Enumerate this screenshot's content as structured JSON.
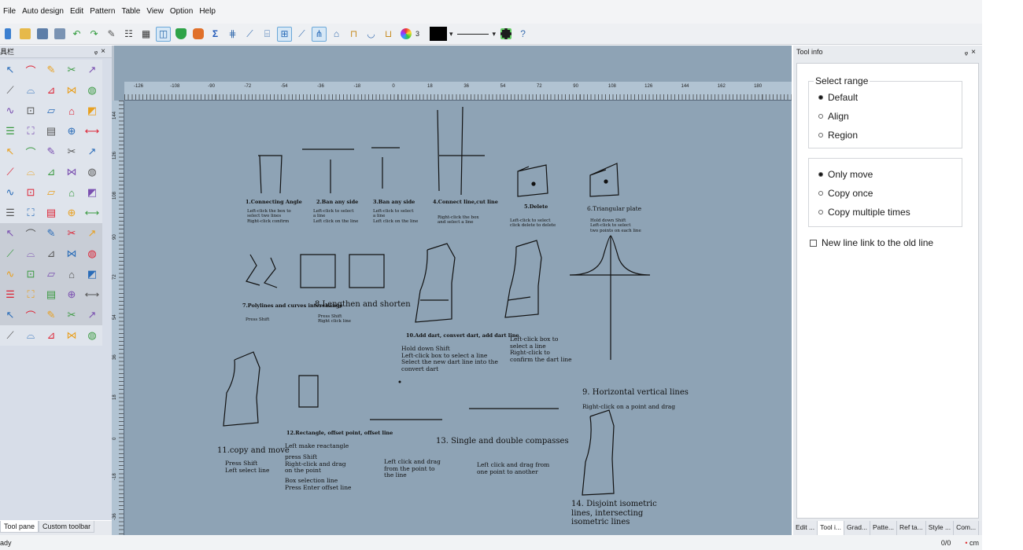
{
  "menu": [
    "File",
    "Auto design",
    "Edit",
    "Pattern",
    "Table",
    "View",
    "Option",
    "Help"
  ],
  "toolbar": {
    "line_weight_value": "3"
  },
  "left_pane": {
    "title": "具栏",
    "tabs": [
      "Tool pane",
      "Custom toolbar"
    ]
  },
  "ruler": {
    "h_ticks": [
      "-126",
      "-108",
      "-90",
      "-72",
      "-54",
      "-36",
      "-18",
      "0",
      "18",
      "36",
      "54",
      "72",
      "90",
      "108",
      "126",
      "144",
      "162",
      "180"
    ],
    "v_ticks": [
      "144",
      "126",
      "108",
      "90",
      "72",
      "54",
      "36",
      "18",
      "0",
      "-18",
      "-36"
    ]
  },
  "canvas": {
    "labels": {
      "l1": "1.Connecting Angle",
      "l1d": "Left-click the box to\nselect two lines\nRight-click confirm",
      "l2": "2.Ban any side",
      "l2d": "Left-click to select\na line\nLeft click on the line",
      "l3": "3.Ban any side",
      "l3d": "Left-click to select\na line\nLeft click on the line",
      "l4": "4.Connect line,cut line",
      "l4d": "Right-click the box\nand select a line",
      "l5": "5.Delete",
      "l5d": "Left-click to select\nclick delete to delete",
      "l6": "6.Triangular plate",
      "l6d": "Hold down Shift\nLeft-click to select\ntwo points on each line",
      "l7": "7.Polylines and curves interchange",
      "l7d": "Press Shift",
      "l8": "8.Lengthen and shorten",
      "l8d": "Press Shift\nRight click line",
      "l10": "10.Add dart, convert dart, add dart line",
      "l10d": "Hold down Shift\nLeft-click box to select a line\nSelect the new dart line into the\nconvert dart",
      "l10e": "Left-click box to\nselect a line\nRight-click to\nconfirm the dart line",
      "l9": "9. Horizontal vertical lines",
      "l9d": "Right-click on a point and drag",
      "l11": "11.copy and move",
      "l11d": "Press Shift\nLeft select line",
      "l12": "12.Rectangle, offset point, offset line",
      "l12d": "Left make reactangle",
      "l12e": "press Shift\nRight-click and drag\non the point",
      "l12f": "Box selection line\nPress Enter offset line",
      "l13": "13. Single and double compasses",
      "l13d": "Left click and drag\nfrom the point to\nthe line",
      "l13e": "Left click and drag from\none point to another",
      "l14": "14. Disjoint isometric\nlines, intersecting\nisometric lines"
    }
  },
  "tool_info": {
    "title": "Tool info",
    "select_range_legend": "Select range",
    "range_options": [
      "Default",
      "Align",
      "Region"
    ],
    "range_selected": 0,
    "move_options": [
      "Only move",
      "Copy once",
      "Copy multiple times"
    ],
    "move_selected": 0,
    "checkbox_label": "New line link to the old line",
    "checkbox_checked": false
  },
  "right_tabs": [
    "Edit ...",
    "Tool i...",
    "Grad...",
    "Patte...",
    "Ref ta...",
    "Style ...",
    "Com..."
  ],
  "status": {
    "left": "ady",
    "count": "0/0",
    "unit": "cm"
  },
  "colors": {
    "canvas": "#8ea3b5",
    "ruler": "#b1c3d2",
    "pane": "#d7dde8"
  }
}
